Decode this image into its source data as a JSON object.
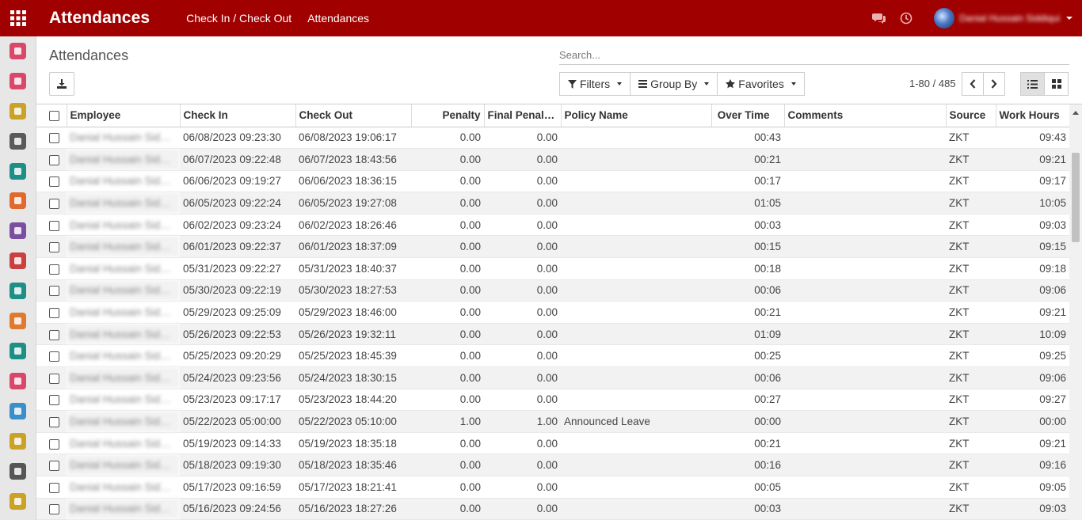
{
  "topbar": {
    "title": "Attendances",
    "menu": [
      "Check In / Check Out",
      "Attendances"
    ],
    "user_name": "Danial Hussain Siddiqui"
  },
  "control": {
    "breadcrumb": "Attendances",
    "search_placeholder": "Search...",
    "filters_label": "Filters",
    "groupby_label": "Group By",
    "favorites_label": "Favorites",
    "pager": "1-80 / 485"
  },
  "table": {
    "headers": [
      "Employee",
      "Check In",
      "Check Out",
      "Penalty",
      "Final Penalty...",
      "Policy Name",
      "Over Time",
      "Comments",
      "Source",
      "Work Hours"
    ],
    "rows": [
      {
        "employee": "Danial Hussain Siddiq...",
        "check_in": "06/08/2023 09:23:30",
        "check_out": "06/08/2023 19:06:17",
        "penalty": "0.00",
        "final_penalty": "0.00",
        "policy": "",
        "overtime": "00:43",
        "comments": "",
        "source": "ZKT",
        "work_hours": "09:43"
      },
      {
        "employee": "Danial Hussain Siddiq...",
        "check_in": "06/07/2023 09:22:48",
        "check_out": "06/07/2023 18:43:56",
        "penalty": "0.00",
        "final_penalty": "0.00",
        "policy": "",
        "overtime": "00:21",
        "comments": "",
        "source": "ZKT",
        "work_hours": "09:21"
      },
      {
        "employee": "Danial Hussain Siddiq...",
        "check_in": "06/06/2023 09:19:27",
        "check_out": "06/06/2023 18:36:15",
        "penalty": "0.00",
        "final_penalty": "0.00",
        "policy": "",
        "overtime": "00:17",
        "comments": "",
        "source": "ZKT",
        "work_hours": "09:17"
      },
      {
        "employee": "Danial Hussain Siddiq...",
        "check_in": "06/05/2023 09:22:24",
        "check_out": "06/05/2023 19:27:08",
        "penalty": "0.00",
        "final_penalty": "0.00",
        "policy": "",
        "overtime": "01:05",
        "comments": "",
        "source": "ZKT",
        "work_hours": "10:05"
      },
      {
        "employee": "Danial Hussain Siddiq...",
        "check_in": "06/02/2023 09:23:24",
        "check_out": "06/02/2023 18:26:46",
        "penalty": "0.00",
        "final_penalty": "0.00",
        "policy": "",
        "overtime": "00:03",
        "comments": "",
        "source": "ZKT",
        "work_hours": "09:03"
      },
      {
        "employee": "Danial Hussain Siddiq...",
        "check_in": "06/01/2023 09:22:37",
        "check_out": "06/01/2023 18:37:09",
        "penalty": "0.00",
        "final_penalty": "0.00",
        "policy": "",
        "overtime": "00:15",
        "comments": "",
        "source": "ZKT",
        "work_hours": "09:15"
      },
      {
        "employee": "Danial Hussain Siddiq...",
        "check_in": "05/31/2023 09:22:27",
        "check_out": "05/31/2023 18:40:37",
        "penalty": "0.00",
        "final_penalty": "0.00",
        "policy": "",
        "overtime": "00:18",
        "comments": "",
        "source": "ZKT",
        "work_hours": "09:18"
      },
      {
        "employee": "Danial Hussain Siddiq...",
        "check_in": "05/30/2023 09:22:19",
        "check_out": "05/30/2023 18:27:53",
        "penalty": "0.00",
        "final_penalty": "0.00",
        "policy": "",
        "overtime": "00:06",
        "comments": "",
        "source": "ZKT",
        "work_hours": "09:06"
      },
      {
        "employee": "Danial Hussain Siddiq...",
        "check_in": "05/29/2023 09:25:09",
        "check_out": "05/29/2023 18:46:00",
        "penalty": "0.00",
        "final_penalty": "0.00",
        "policy": "",
        "overtime": "00:21",
        "comments": "",
        "source": "ZKT",
        "work_hours": "09:21"
      },
      {
        "employee": "Danial Hussain Siddiq...",
        "check_in": "05/26/2023 09:22:53",
        "check_out": "05/26/2023 19:32:11",
        "penalty": "0.00",
        "final_penalty": "0.00",
        "policy": "",
        "overtime": "01:09",
        "comments": "",
        "source": "ZKT",
        "work_hours": "10:09"
      },
      {
        "employee": "Danial Hussain Siddiq...",
        "check_in": "05/25/2023 09:20:29",
        "check_out": "05/25/2023 18:45:39",
        "penalty": "0.00",
        "final_penalty": "0.00",
        "policy": "",
        "overtime": "00:25",
        "comments": "",
        "source": "ZKT",
        "work_hours": "09:25"
      },
      {
        "employee": "Danial Hussain Siddiq...",
        "check_in": "05/24/2023 09:23:56",
        "check_out": "05/24/2023 18:30:15",
        "penalty": "0.00",
        "final_penalty": "0.00",
        "policy": "",
        "overtime": "00:06",
        "comments": "",
        "source": "ZKT",
        "work_hours": "09:06"
      },
      {
        "employee": "Danial Hussain Siddiq...",
        "check_in": "05/23/2023 09:17:17",
        "check_out": "05/23/2023 18:44:20",
        "penalty": "0.00",
        "final_penalty": "0.00",
        "policy": "",
        "overtime": "00:27",
        "comments": "",
        "source": "ZKT",
        "work_hours": "09:27"
      },
      {
        "employee": "Danial Hussain Siddiq...",
        "check_in": "05/22/2023 05:00:00",
        "check_out": "05/22/2023 05:10:00",
        "penalty": "1.00",
        "final_penalty": "1.00",
        "policy": "Announced Leave",
        "overtime": "00:00",
        "comments": "",
        "source": "ZKT",
        "work_hours": "00:00"
      },
      {
        "employee": "Danial Hussain Siddiq...",
        "check_in": "05/19/2023 09:14:33",
        "check_out": "05/19/2023 18:35:18",
        "penalty": "0.00",
        "final_penalty": "0.00",
        "policy": "",
        "overtime": "00:21",
        "comments": "",
        "source": "ZKT",
        "work_hours": "09:21"
      },
      {
        "employee": "Danial Hussain Siddiq...",
        "check_in": "05/18/2023 09:19:30",
        "check_out": "05/18/2023 18:35:46",
        "penalty": "0.00",
        "final_penalty": "0.00",
        "policy": "",
        "overtime": "00:16",
        "comments": "",
        "source": "ZKT",
        "work_hours": "09:16"
      },
      {
        "employee": "Danial Hussain Siddiq...",
        "check_in": "05/17/2023 09:16:59",
        "check_out": "05/17/2023 18:21:41",
        "penalty": "0.00",
        "final_penalty": "0.00",
        "policy": "",
        "overtime": "00:05",
        "comments": "",
        "source": "ZKT",
        "work_hours": "09:05"
      },
      {
        "employee": "Danial Hussain Siddiq...",
        "check_in": "05/16/2023 09:24:56",
        "check_out": "05/16/2023 18:27:26",
        "penalty": "0.00",
        "final_penalty": "0.00",
        "policy": "",
        "overtime": "00:03",
        "comments": "",
        "source": "ZKT",
        "work_hours": "09:03"
      }
    ]
  },
  "theme": {
    "topbar_color": "#a00000",
    "sidebar_color": "#e7e7e7",
    "row_alt_color": "#f2f2f2"
  },
  "sidebar_icons": [
    {
      "name": "dashboard-icon",
      "color": "#d9486a"
    },
    {
      "name": "discuss-icon",
      "color": "#d9486a"
    },
    {
      "name": "calendar-icon",
      "color": "#c9a227"
    },
    {
      "name": "notes-icon",
      "color": "#5a5a5a"
    },
    {
      "name": "contacts-icon",
      "color": "#1e8f86"
    },
    {
      "name": "website-icon",
      "color": "#e06a2e"
    },
    {
      "name": "apps-icon",
      "color": "#7a4fa0"
    },
    {
      "name": "timer-icon",
      "color": "#c94040"
    },
    {
      "name": "tag-icon",
      "color": "#1e8f86"
    },
    {
      "name": "survey-icon",
      "color": "#e07a2e"
    },
    {
      "name": "employees-icon",
      "color": "#1e8f86"
    },
    {
      "name": "recruitment-icon",
      "color": "#d9486a"
    },
    {
      "name": "attendance-icon",
      "color": "#3a8fc9"
    },
    {
      "name": "appraisal-icon",
      "color": "#c9a227"
    },
    {
      "name": "payroll-icon",
      "color": "#555555"
    },
    {
      "name": "lunch-icon",
      "color": "#c9a227"
    }
  ]
}
